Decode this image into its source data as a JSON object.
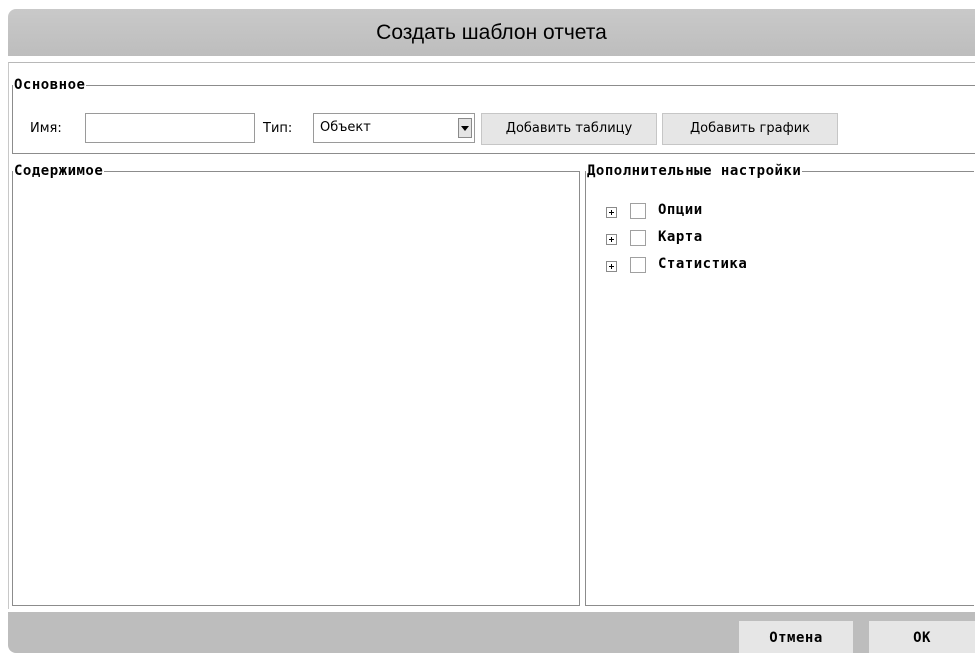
{
  "dialog": {
    "title": "Создать шаблон отчета"
  },
  "basic": {
    "legend": "Основное",
    "name_label": "Имя:",
    "name_value": "",
    "type_label": "Тип:",
    "type_value": "Объект",
    "add_table_label": "Добавить таблицу",
    "add_chart_label": "Добавить график"
  },
  "content": {
    "legend": "Содержимое"
  },
  "advanced": {
    "legend": "Дополнительные настройки",
    "items": [
      {
        "label": "Опции",
        "checked": false
      },
      {
        "label": "Карта",
        "checked": false
      },
      {
        "label": "Статистика",
        "checked": false
      }
    ]
  },
  "footer": {
    "cancel_label": "Отмена",
    "ok_label": "OK"
  },
  "colors": {
    "titlebar": "#c4c4c4",
    "footer": "#bdbdbd",
    "button": "#e6e6e6",
    "border": "#8c8c8c"
  },
  "icons": {
    "expander": "plus-expander-icon",
    "dropdown": "chevron-down-icon"
  }
}
